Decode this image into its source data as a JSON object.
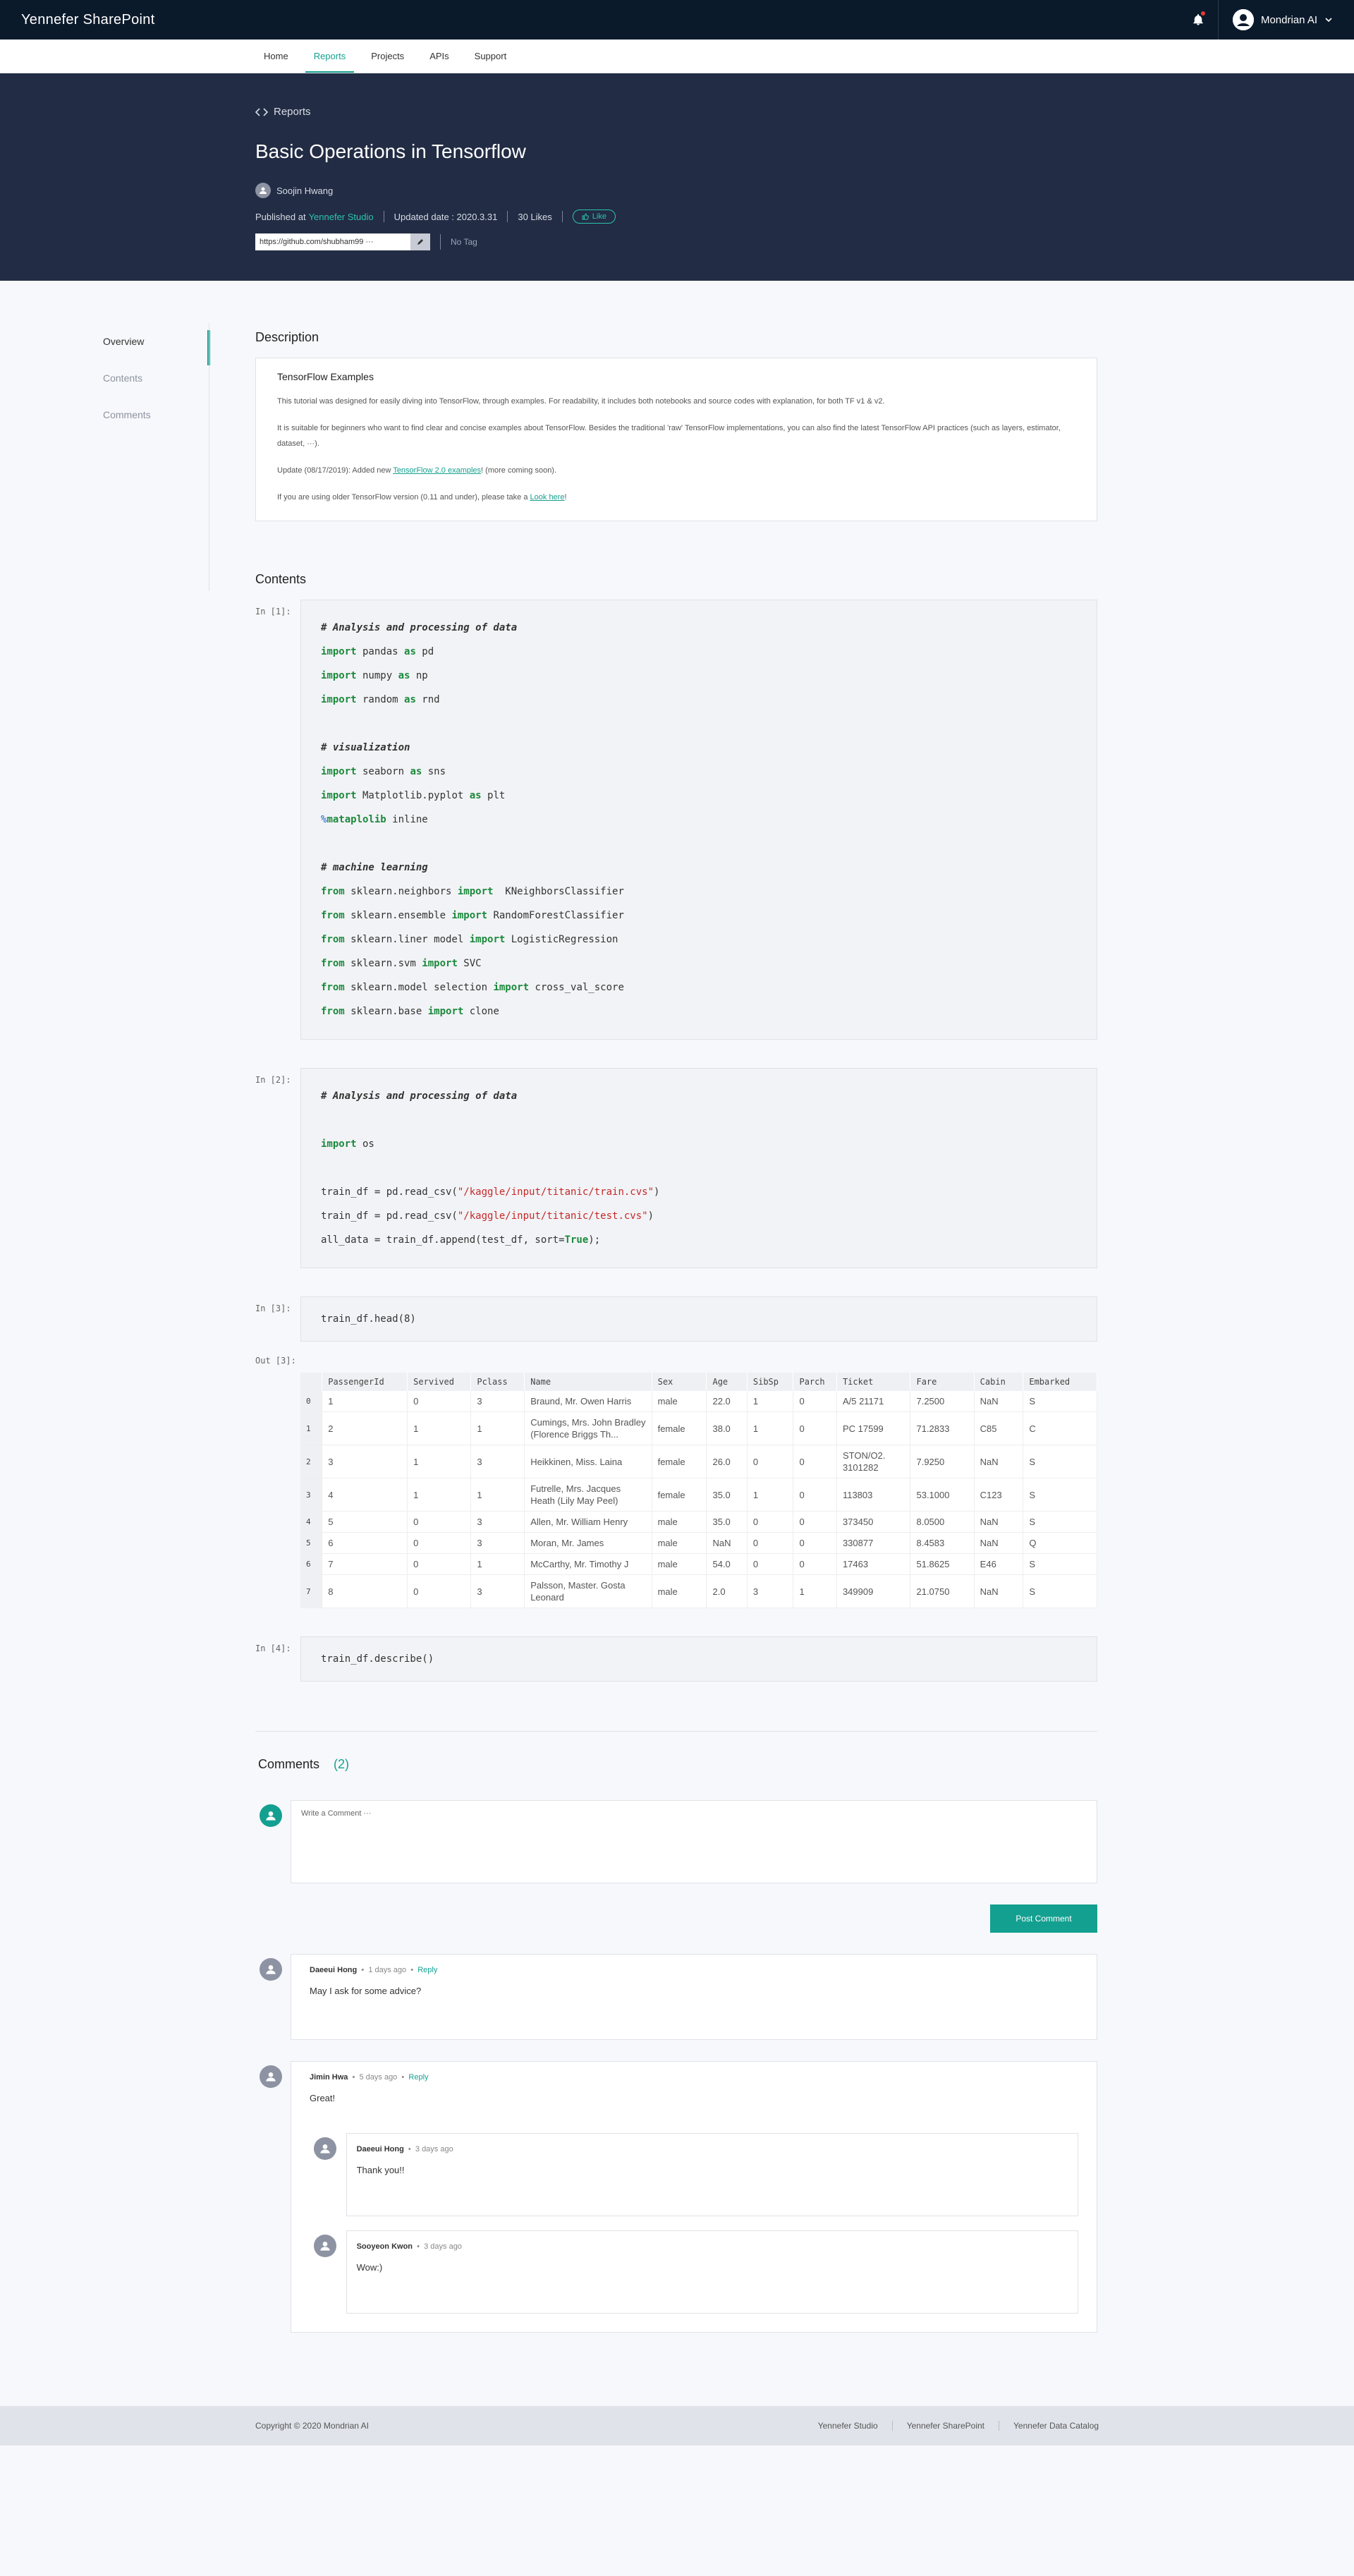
{
  "app": {
    "brand": "Yennefer SharePoint",
    "user_name": "Mondrian AI"
  },
  "nav": [
    "Home",
    "Reports",
    "Projects",
    "APIs",
    "Support"
  ],
  "nav_active": "Reports",
  "hero": {
    "back_label": "Reports",
    "title": "Basic Operations in Tensorflow",
    "author": "Soojin Hwang",
    "published_prefix": "Published at",
    "published_at": "Yennefer Studio",
    "updated": "Updated date : 2020.3.31",
    "likes": "30 Likes",
    "like_button": "Like",
    "url": "https://github.com/shubham99 ···",
    "tag": "No Tag"
  },
  "sidenav": [
    "Overview",
    "Contents",
    "Comments"
  ],
  "description": {
    "section_title": "Description",
    "heading": "TensorFlow Examples",
    "p1": "This tutorial was designed for easily diving into TensorFlow, through examples. For readability, it includes both notebooks and source codes with explanation, for both TF v1 & v2.",
    "p2": "It is suitable for beginners who want to find clear and concise examples about TensorFlow. Besides the traditional 'raw' TensorFlow implementations, you can also find the latest TensorFlow API practices (such as layers, estimator, dataset, ···).",
    "p3_before": "Update (08/17/2019): Added new ",
    "p3_link": "TensorFlow 2.0 examples",
    "p3_after": "! (more coming soon).",
    "p4_before": "If you are using older TensorFlow version (0.11 and under), please take a ",
    "p4_link": "Look here",
    "p4_after": "!"
  },
  "contents": {
    "section_title": "Contents",
    "cell1_label": "In [1]:",
    "cell2_label": "In [2]:",
    "cell3_label": "In [3]:",
    "out3_label": "Out [3]:",
    "cell4_label": "In [4]:",
    "cell3_code": "train_df.head(8)",
    "cell4_code": "train_df.describe()",
    "cell1": [
      [
        [
          "cm",
          "# Analysis and processing of data"
        ]
      ],
      [
        [
          "kw",
          "import"
        ],
        [
          "",
          " pandas "
        ],
        [
          "kw",
          "as"
        ],
        [
          "",
          " pd"
        ]
      ],
      [
        [
          "kw",
          "import"
        ],
        [
          "",
          " numpy "
        ],
        [
          "kw",
          "as"
        ],
        [
          "",
          " np"
        ]
      ],
      [
        [
          "kw",
          "import"
        ],
        [
          "",
          " random "
        ],
        [
          "kw",
          "as"
        ],
        [
          "",
          " rnd"
        ]
      ],
      [],
      [
        [
          "cm",
          "# visualization"
        ]
      ],
      [
        [
          "kw",
          "import"
        ],
        [
          "",
          " seaborn "
        ],
        [
          "kw",
          "as"
        ],
        [
          "",
          " sns"
        ]
      ],
      [
        [
          "kw",
          "import"
        ],
        [
          "",
          " Matplotlib.pyplot "
        ],
        [
          "kw",
          "as"
        ],
        [
          "",
          " plt"
        ]
      ],
      [
        [
          "mg",
          "%"
        ],
        [
          "kw",
          "mataplolib"
        ],
        [
          "",
          " inline"
        ]
      ],
      [],
      [
        [
          "cm",
          "# machine learning"
        ]
      ],
      [
        [
          "kw",
          "from"
        ],
        [
          "",
          " sklearn.neighbors "
        ],
        [
          "kw",
          "import"
        ],
        [
          "",
          "  KNeighborsClassifier"
        ]
      ],
      [
        [
          "kw",
          "from"
        ],
        [
          "",
          " sklearn.ensemble "
        ],
        [
          "kw",
          "import"
        ],
        [
          "",
          " RandomForestClassifier"
        ]
      ],
      [
        [
          "kw",
          "from"
        ],
        [
          "",
          " sklearn.liner model "
        ],
        [
          "kw",
          "import"
        ],
        [
          "",
          " LogisticRegression"
        ]
      ],
      [
        [
          "kw",
          "from"
        ],
        [
          "",
          " sklearn.svm "
        ],
        [
          "kw",
          "import"
        ],
        [
          "",
          " SVC"
        ]
      ],
      [
        [
          "kw",
          "from"
        ],
        [
          "",
          " sklearn.model selection "
        ],
        [
          "kw",
          "import"
        ],
        [
          "",
          " cross_val_score"
        ]
      ],
      [
        [
          "kw",
          "from"
        ],
        [
          "",
          " sklearn.base "
        ],
        [
          "kw",
          "import"
        ],
        [
          "",
          " clone"
        ]
      ]
    ],
    "cell2": [
      [
        [
          "cm",
          "# Analysis and processing of data"
        ]
      ],
      [],
      [
        [
          "kw",
          "import"
        ],
        [
          "",
          " os"
        ]
      ],
      [],
      [
        [
          "",
          "train_df = pd.read_csv("
        ],
        [
          "str",
          "\"/kaggle/input/titanic/train.cvs\""
        ],
        [
          "",
          ")"
        ]
      ],
      [
        [
          "",
          "train_df = pd.read_csv("
        ],
        [
          "str",
          "\"/kaggle/input/titanic/test.cvs\""
        ],
        [
          "",
          ")"
        ]
      ],
      [
        [
          "",
          "all_data = train_df.append(test_df, sort="
        ],
        [
          "kw",
          "True"
        ],
        [
          "",
          ");"
        ]
      ]
    ],
    "table": {
      "columns": [
        "",
        "PassengerId",
        "Servived",
        "Pclass",
        "Name",
        "Sex",
        "Age",
        "SibSp",
        "Parch",
        "Ticket",
        "Fare",
        "Cabin",
        "Embarked"
      ],
      "rows": [
        [
          "0",
          "1",
          "0",
          "3",
          "Braund, Mr. Owen Harris",
          "male",
          "22.0",
          "1",
          "0",
          "A/5 21171",
          "7.2500",
          "NaN",
          "S"
        ],
        [
          "1",
          "2",
          "1",
          "1",
          "Cumings, Mrs. John Bradley (Florence Briggs Th...",
          "female",
          "38.0",
          "1",
          "0",
          "PC 17599",
          "71.2833",
          "C85",
          "C"
        ],
        [
          "2",
          "3",
          "1",
          "3",
          "Heikkinen, Miss. Laina",
          "female",
          "26.0",
          "0",
          "0",
          "STON/O2. 3101282",
          "7.9250",
          "NaN",
          "S"
        ],
        [
          "3",
          "4",
          "1",
          "1",
          "Futrelle, Mrs. Jacques Heath (Lily May Peel)",
          "female",
          "35.0",
          "1",
          "0",
          "113803",
          "53.1000",
          "C123",
          "S"
        ],
        [
          "4",
          "5",
          "0",
          "3",
          "Allen, Mr. William Henry",
          "male",
          "35.0",
          "0",
          "0",
          "373450",
          "8.0500",
          "NaN",
          "S"
        ],
        [
          "5",
          "6",
          "0",
          "3",
          "Moran, Mr. James",
          "male",
          "NaN",
          "0",
          "0",
          "330877",
          "8.4583",
          "NaN",
          "Q"
        ],
        [
          "6",
          "7",
          "0",
          "1",
          "McCarthy, Mr. Timothy J",
          "male",
          "54.0",
          "0",
          "0",
          "17463",
          "51.8625",
          "E46",
          "S"
        ],
        [
          "7",
          "8",
          "0",
          "3",
          "Palsson, Master. Gosta Leonard",
          "male",
          "2.0",
          "3",
          "1",
          "349909",
          "21.0750",
          "NaN",
          "S"
        ]
      ]
    }
  },
  "comments": {
    "title": "Comments",
    "count": "(2)",
    "placeholder": "Write a Comment ···",
    "post_button": "Post Comment",
    "reply_label": "Reply",
    "items": [
      {
        "author": "Daeeui Hong",
        "time": "1 days ago",
        "text": "May I ask for some advice?"
      },
      {
        "author": "Jimin Hwa",
        "time": "5 days ago",
        "text": "Great!"
      }
    ],
    "replies": [
      {
        "author": "Daeeui Hong",
        "time": "3 days ago",
        "text": "Thank you!!"
      },
      {
        "author": "Sooyeon Kwon",
        "time": "3 days ago",
        "text": "Wow:)"
      }
    ]
  },
  "footer": {
    "copyright": "Copyright © 2020 Mondrian AI",
    "links": [
      "Yennefer Studio",
      "Yennefer SharePoint",
      "Yennefer Data Catalog"
    ]
  },
  "colors": {
    "accent": "#14a090",
    "topbar": "#0b1a2b",
    "hero": "#222c44"
  }
}
